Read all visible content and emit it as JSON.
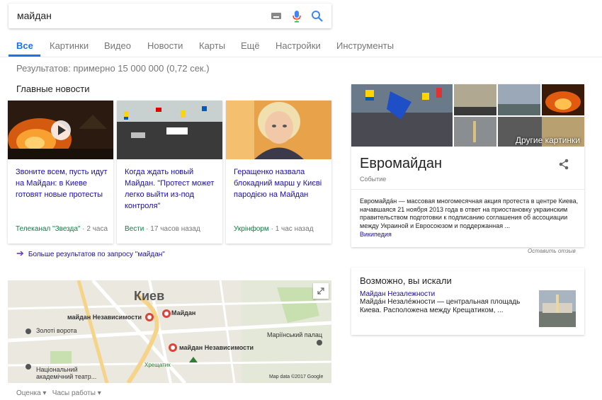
{
  "search": {
    "query": "майдан"
  },
  "tabs": [
    {
      "label": "Все"
    },
    {
      "label": "Картинки"
    },
    {
      "label": "Видео"
    },
    {
      "label": "Новости"
    },
    {
      "label": "Карты"
    },
    {
      "label": "Ещё"
    },
    {
      "label": "Настройки"
    },
    {
      "label": "Инструменты"
    }
  ],
  "results_count": "Результатов: примерно 15 000 000 (0,72 сек.)",
  "news_section_title": "Главные новости",
  "news": [
    {
      "title": "Звоните всем, пусть идут на Майдан: в Киеве готовят новые протесты",
      "source": "Телеканал \"Звезда\"",
      "time": " · 2 часа"
    },
    {
      "title": "Когда ждать новый Майдан. \"Протест может легко выйти из-под контроля\"",
      "source": "Вести",
      "time": " · 17 часов назад"
    },
    {
      "title": "Геращенко назвала блокадний марш у Києві пародією на Майдан",
      "source": "Укрінформ",
      "time": " · 1 час назад"
    }
  ],
  "more_news": "Больше результатов по запросу \"майдан\"",
  "map": {
    "city": "Киев",
    "labels": [
      "майдан Независимости",
      "Майдан",
      "майдан Независимости",
      "Золоті ворота",
      "Маріїнський палац",
      "Національний академічний театр...",
      "Хрещатик"
    ],
    "attribution": "Map data ©2017 Google",
    "filters": [
      "Оценка ▾",
      "Часы работы ▾"
    ]
  },
  "knowledge_panel": {
    "title": "Евромайдан",
    "subtitle": "Событие",
    "description": "Евромайда́н — массовая многомесячная акция протеста в центре Киева, начавшаяся 21 ноября 2013 года в ответ на приостановку украинским правительством подготовки к подписанию соглашения об ассоциации между Украиной и Евросоюзом и поддержанная ...",
    "source_link": "Википедия",
    "more_images": "Другие картинки",
    "feedback": "Оставить отзыв"
  },
  "did_you_mean": {
    "title": "Возможно, вы искали",
    "link": "Майдан Незалежности",
    "description": "Майда́н Незале́жности — центральная площадь Киева. Расположена между Крещатиком, ..."
  },
  "colors": {
    "accent": "#1a73e8",
    "link": "#1a0dab",
    "source_green": "#0b8043"
  }
}
